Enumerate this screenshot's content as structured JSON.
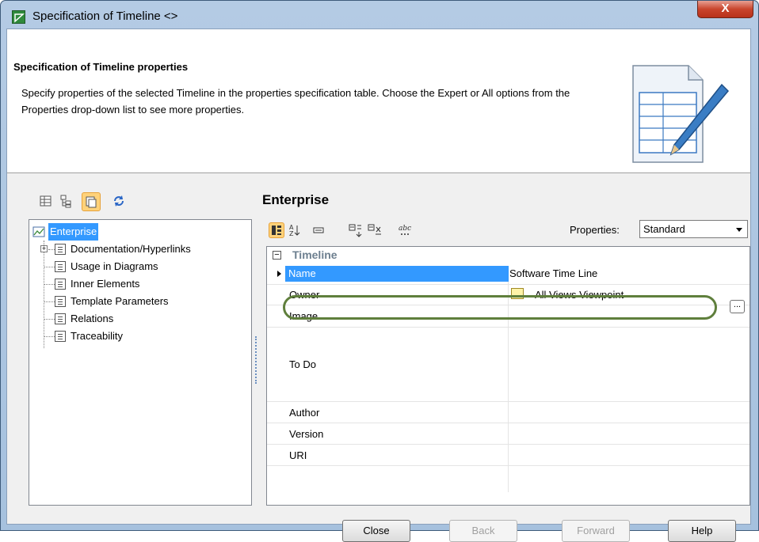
{
  "window": {
    "title": "Specification of Timeline <>",
    "close_glyph": "X"
  },
  "header": {
    "title": "Specification of Timeline properties",
    "description": "Specify properties of the selected Timeline in the properties specification table. Choose the Expert or All options from the Properties drop-down list to see more properties."
  },
  "tree": {
    "root": "Enterprise",
    "items": [
      {
        "label": "Documentation/Hyperlinks",
        "expandable": true
      },
      {
        "label": "Usage in Diagrams"
      },
      {
        "label": "Inner Elements"
      },
      {
        "label": "Template Parameters"
      },
      {
        "label": "Relations"
      },
      {
        "label": "Traceability"
      }
    ]
  },
  "panel": {
    "title": "Enterprise",
    "properties_label": "Properties:",
    "properties_value": "Standard",
    "group": "Timeline",
    "rows": [
      {
        "name": "Name",
        "value": "Software Time Line"
      },
      {
        "name": "Owner",
        "value": "All Views Viewpoint"
      },
      {
        "name": "Image",
        "value": ""
      },
      {
        "name": "To Do",
        "value": ""
      },
      {
        "name": "Author",
        "value": ""
      },
      {
        "name": "Version",
        "value": ""
      },
      {
        "name": "URI",
        "value": ""
      }
    ],
    "ellipsis": "..."
  },
  "buttons": {
    "close": "Close",
    "back": "Back",
    "forward": "Forward",
    "help": "Help"
  }
}
